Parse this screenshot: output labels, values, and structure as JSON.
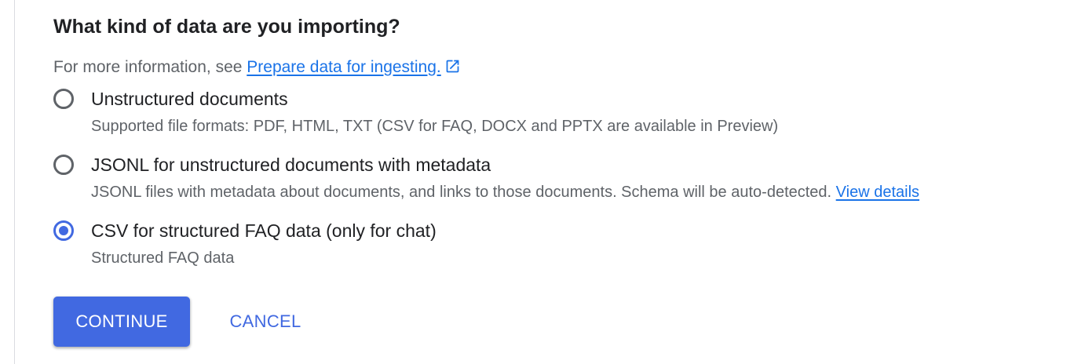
{
  "section": {
    "title": "What kind of data are you importing?",
    "info_prefix": "For more information, see ",
    "info_link": "Prepare data for ingesting."
  },
  "options": [
    {
      "label": "Unstructured documents",
      "description": "Supported file formats: PDF, HTML, TXT (CSV for FAQ, DOCX and PPTX are available in Preview)",
      "selected": false
    },
    {
      "label": "JSONL for unstructured documents with metadata",
      "description": "JSONL files with metadata about documents, and links to those documents. Schema will be auto-detected. ",
      "link": "View details",
      "selected": false
    },
    {
      "label": "CSV for structured FAQ data (only for chat)",
      "description": "Structured FAQ data",
      "selected": true
    }
  ],
  "actions": {
    "continue_label": "CONTINUE",
    "cancel_label": "CANCEL"
  },
  "icons": {
    "external_link": "open-in-new-icon"
  },
  "colors": {
    "accent": "#4169e1",
    "link": "#1a73e8",
    "text_primary": "#202124",
    "text_secondary": "#5f6368",
    "radio_unchecked": "#5f6368"
  }
}
